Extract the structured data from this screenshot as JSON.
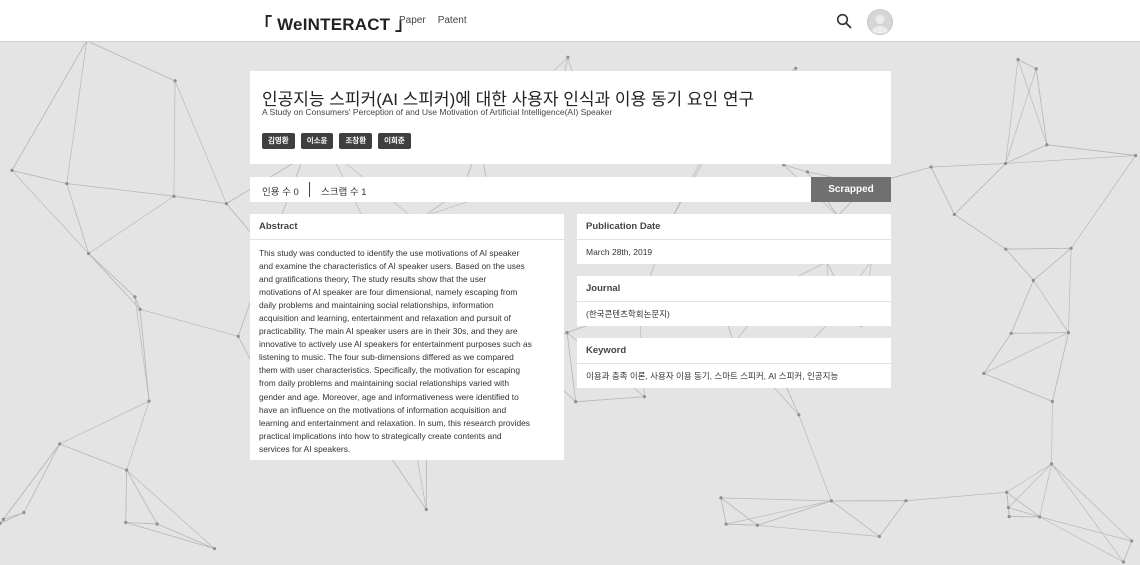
{
  "header": {
    "logo": "「 WeINTERACT 」",
    "nav": [
      "Paper",
      "Patent"
    ]
  },
  "paper": {
    "title_ko": "인공지능 스피커(AI 스피커)에 대한 사용자 인식과 이용 동기 요인 연구",
    "title_en": "A Study on Consumers' Perception of and Use Motivation of Artificial Intelligence(AI) Speaker",
    "authors": [
      "김영환",
      "이소윤",
      "조창환",
      "이희준"
    ]
  },
  "stats": {
    "citations": "인용 수 0",
    "scraps": "스크랩 수 1",
    "scrap_button": "Scrapped"
  },
  "abstract": {
    "heading": "Abstract",
    "lines": [
      "This study was conducted to identify the use motivations of AI speaker",
      "and examine the characteristics of AI speaker users. Based on the uses",
      "and gratifications theory, The study results show that the user",
      "motivations of AI speaker are four dimensional, namely escaping from",
      "daily problems and maintaining social relationships, information",
      "acquisition and learning, entertainment and relaxation and pursuit of",
      "practicability. The main AI speaker users are in their 30s, and they are",
      "innovative to actively use AI speakers for entertainment purposes such as",
      "listening to music. The four sub-dimensions differed as we compared",
      "them with user characteristics. Specifically, the motivation for escaping",
      "from daily problems and maintaining social relationships varied with",
      "gender and age. Moreover, age and informativeness were identified to",
      "have an influence on the motivations of information acquisition and",
      "learning and entertainment and relaxation. In sum, this research provides",
      "practical implications into how to strategically create contents and",
      "services for AI speakers."
    ]
  },
  "publication": {
    "heading": "Publication Date",
    "value": "March 28th, 2019"
  },
  "journal": {
    "heading": "Journal",
    "value": "(한국콘텐츠학회논문지)"
  },
  "keyword": {
    "heading": "Keyword",
    "value": "이용과 충족 이론, 사용자 이용 동기, 스마트 스피커, AI 스피커, 인공지능"
  },
  "icons": {
    "search": "search-icon",
    "avatar": "user-avatar-icon"
  },
  "colors": {
    "author_tag": "#3f3f3f",
    "scrap_button": "#707070",
    "background": "#e4e4e4"
  }
}
